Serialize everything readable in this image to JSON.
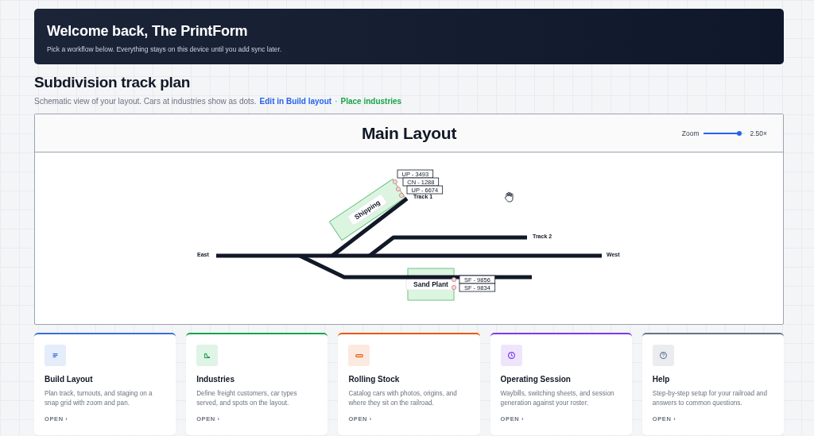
{
  "banner": {
    "title": "Welcome back, The PrintForm",
    "subtitle": "Pick a workflow below. Everything stays on this device until you add sync later."
  },
  "plan": {
    "title": "Subdivision track plan",
    "subtitle": "Schematic view of your layout. Cars at industries show as dots.",
    "links": [
      {
        "label": "Edit in Build layout",
        "color": "#2563eb"
      },
      {
        "label": "Place industries",
        "color": "#16a34a"
      }
    ],
    "separator": "·"
  },
  "map": {
    "title": "Main Layout",
    "zoom": {
      "label": "Zoom",
      "level": 0.85,
      "reading": "2.50×"
    },
    "directions": [
      "East",
      "West"
    ],
    "tracks": [
      {
        "label": "Track 1"
      },
      {
        "label": "Track 2"
      }
    ],
    "industries": [
      {
        "name": "Shipping",
        "cars": [
          "UP - 3493",
          "CN - 1288",
          "UP - 6674"
        ]
      },
      {
        "name": "Sand Plant",
        "cars": [
          "SF - 9856",
          "SF - 9834"
        ]
      }
    ]
  },
  "cards": [
    {
      "title": "Build Layout",
      "description": "Plan track, turnouts, and staging on a snap grid with zoom and pan.",
      "action": "OPEN ›",
      "color": "#3b6fd8"
    },
    {
      "title": "Industries",
      "description": "Define freight customers, car types served, and spots on the layout.",
      "action": "OPEN ›",
      "color": "#16a34a"
    },
    {
      "title": "Rolling Stock",
      "description": "Catalog cars with photos, origins, and where they sit on the railroad.",
      "action": "OPEN ›",
      "color": "#ea580c"
    },
    {
      "title": "Operating Session",
      "description": "Waybills, switching sheets, and session generation against your roster.",
      "action": "OPEN ›",
      "color": "#7c3aed"
    },
    {
      "title": "Help",
      "description": "Step-by-step setup for your railroad and answers to common questions.",
      "action": "OPEN ›",
      "color": "#64748b"
    }
  ]
}
